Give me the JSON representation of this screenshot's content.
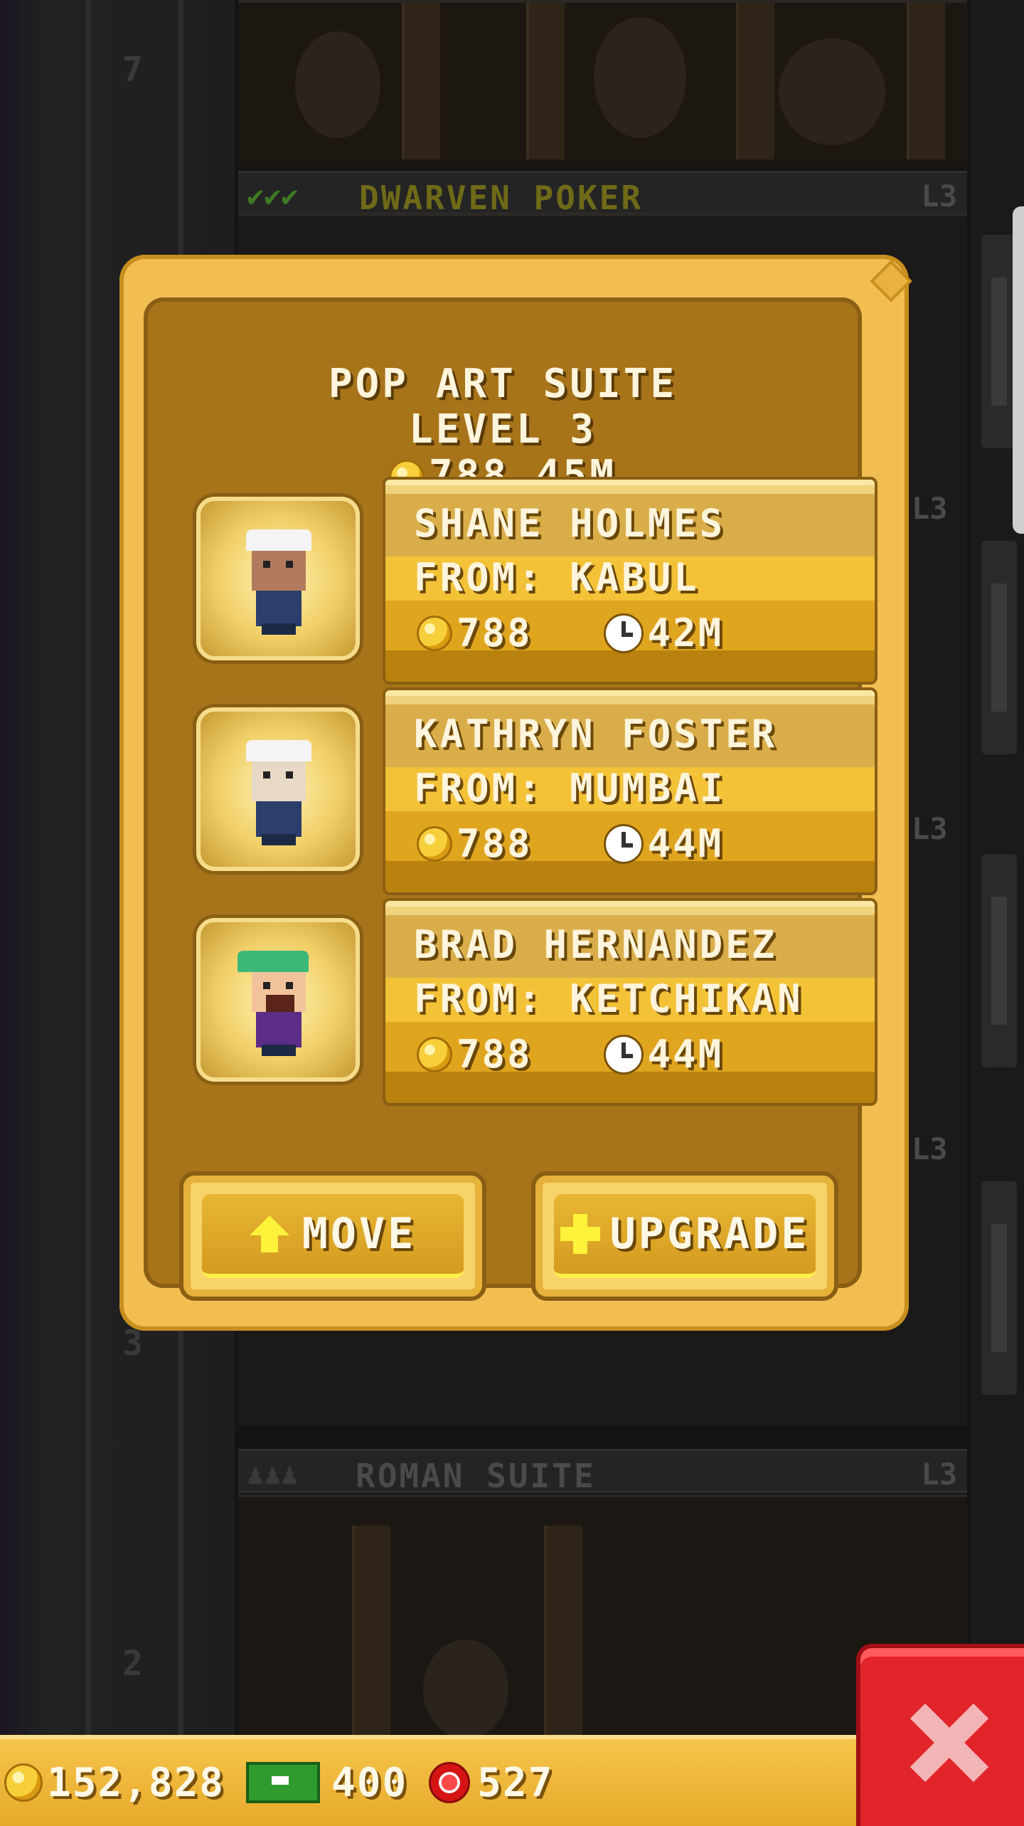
{
  "background": {
    "floor_numbers": [
      "7",
      "3",
      "2"
    ],
    "floor_headers": [
      {
        "name": "DWARVEN POKER",
        "level": "L3",
        "color": "#6f6a17"
      },
      {
        "name": "ROMAN SUITE",
        "level": "L3",
        "color": "#4a4a4a"
      }
    ],
    "side_levels": [
      "L3",
      "L3",
      "L3",
      "L3"
    ]
  },
  "modal": {
    "title": "POP ART SUITE",
    "level": "LEVEL 3",
    "coins": "788",
    "time": "45M"
  },
  "guests": [
    {
      "name": "SHANE HOLMES",
      "from": "FROM: KABUL",
      "coins": "788",
      "time": "42M",
      "hat": "#f4f4f4",
      "skin": "#b27a5c",
      "shirt": "#2c3e6b"
    },
    {
      "name": "KATHRYN FOSTER",
      "from": "FROM: MUMBAI",
      "coins": "788",
      "time": "44M",
      "hat": "#f4f4f4",
      "skin": "#e7d9c6",
      "shirt": "#2c3e6b"
    },
    {
      "name": "BRAD HERNANDEZ",
      "from": "FROM: KETCHIKAN",
      "coins": "788",
      "time": "44M",
      "hat": "#3cb878",
      "skin": "#f2c39b",
      "shirt": "#5b2d86"
    }
  ],
  "buttons": {
    "move": "MOVE",
    "upgrade": "UPGRADE"
  },
  "hud": {
    "coins": "152,828",
    "bux": "400",
    "chips": "527"
  },
  "colors": {
    "panel_gold": "#f2be52",
    "panel_inner": "#a7741a",
    "close_red": "#e2252a"
  }
}
